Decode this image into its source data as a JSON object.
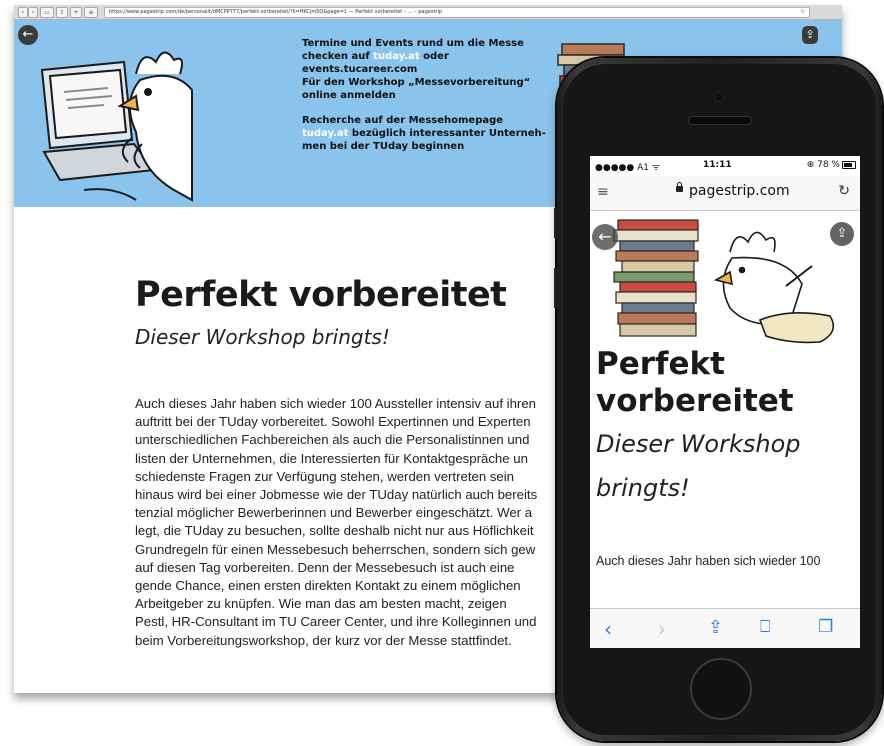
{
  "desktop": {
    "url": "https://www.pagestrip.com/de/personal/t/dMCPP7T7/perfekt-vorbereitet/?li=HKCJm5Q&page=1 — Perfekt vorbereitet – ... – pagestrip",
    "hero": {
      "line1": "Termine und Events rund um die Messe",
      "line2a": "checken auf ",
      "link1": "tuday.at",
      "line2b": " oder",
      "line3": "events.tucareer.com",
      "line4": "Für den Workshop „Messevorbereitung“",
      "line5": "online anmelden",
      "line6": "Recherche auf der Messehomepage",
      "link2": "tuday.at",
      "line7b": " bezüglich interessanter Unterneh-",
      "line8": "men bei der TUday beginnen"
    },
    "title": "Perfekt vorbereitet",
    "subtitle": "Dieser Workshop bringts!",
    "body_lines": [
      "Auch dieses Jahr haben sich wieder 100 Aussteller intensiv auf ihren",
      "auftritt bei der TUday vorbereitet. Sowohl Expertinnen und Experten",
      "unterschiedlichen Fachbereichen als auch die Personalistinnen und",
      "listen der Unternehmen, die Interessierten für Kontaktgespräche un",
      "schiedenste Fragen zur Verfügung stehen, werden vertreten sein",
      "hinaus wird bei einer Jobmesse wie der TUday natürlich auch bereits",
      "tenzial möglicher Bewerberinnen und Bewerber eingeschätzt. Wer a",
      "legt, die TUday zu besuchen, sollte deshalb nicht nur aus Höflichkeit",
      "Grundregeln für einen Messebesuch beherrschen, sondern sich gew",
      "auf diesen Tag vorbereiten. Denn der Messebesuch ist auch eine",
      "gende Chance, einen ersten direkten Kontakt zu einem möglichen",
      "Arbeitgeber zu knüpfen. Wie man das am besten macht, zeigen",
      "Pestl, HR-Consultant im TU Career Center, und ihre Kolleginnen und",
      "beim Vorbereitungsworkshop, der kurz vor der Messe stattfindet."
    ],
    "accent": "#8ac4ec"
  },
  "mobile": {
    "status_left": "●●●●● A1 ᯤ",
    "time": "11:11",
    "battery_text": "⊕ 78 %",
    "domain": "pagestrip.com",
    "title": "Perfekt vorbereitet",
    "subtitle": "Dieser Workshop bringts!",
    "body_first_line": "Auch dieses Jahr haben sich wieder 100"
  }
}
